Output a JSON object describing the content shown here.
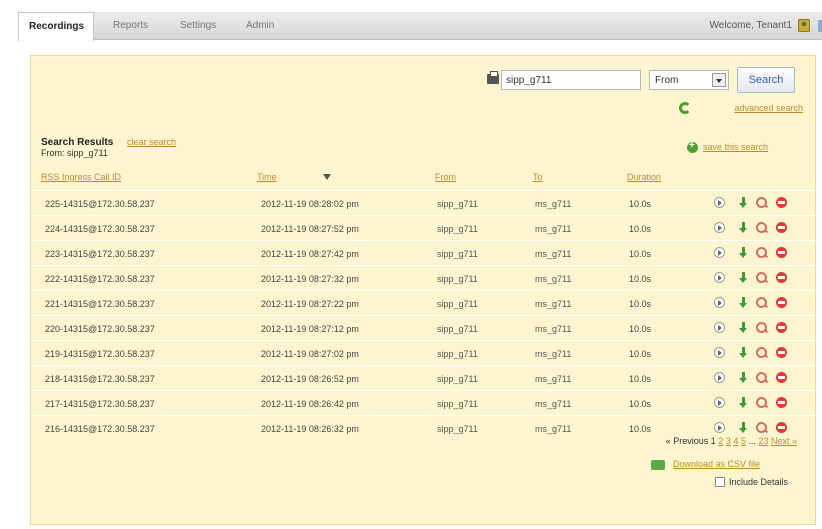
{
  "nav": {
    "tabs": [
      {
        "label": "Recordings",
        "active": true
      },
      {
        "label": "Reports",
        "active": false
      },
      {
        "label": "Settings",
        "active": false
      },
      {
        "label": "Admin",
        "active": false
      }
    ],
    "welcome": "Welcome, Tenant1"
  },
  "search": {
    "value": "sipp_g711",
    "select_value": "From",
    "button": "Search",
    "advanced_link": "advanced search"
  },
  "results": {
    "title": "Search Results",
    "clear_link": "clear search",
    "from_line": "From: sipp_g711",
    "save_link": "save this search"
  },
  "table": {
    "headers": [
      "RSS Ingress Call ID",
      "Time",
      "From",
      "To",
      "Duration"
    ],
    "rows": [
      {
        "call_id": "225-14315@172.30.58.237",
        "time": "2012-11-19 08:28:02 pm",
        "from": "sipp_g711",
        "to": "ms_g711",
        "duration": "10.0s"
      },
      {
        "call_id": "224-14315@172.30.58.237",
        "time": "2012-11-19 08:27:52 pm",
        "from": "sipp_g711",
        "to": "ms_g711",
        "duration": "10.0s"
      },
      {
        "call_id": "223-14315@172.30.58.237",
        "time": "2012-11-19 08:27:42 pm",
        "from": "sipp_g711",
        "to": "ms_g711",
        "duration": "10.0s"
      },
      {
        "call_id": "222-14315@172.30.58.237",
        "time": "2012-11-19 08:27:32 pm",
        "from": "sipp_g711",
        "to": "ms_g711",
        "duration": "10.0s"
      },
      {
        "call_id": "221-14315@172.30.58.237",
        "time": "2012-11-19 08:27:22 pm",
        "from": "sipp_g711",
        "to": "ms_g711",
        "duration": "10.0s"
      },
      {
        "call_id": "220-14315@172.30.58.237",
        "time": "2012-11-19 08:27:12 pm",
        "from": "sipp_g711",
        "to": "ms_g711",
        "duration": "10.0s"
      },
      {
        "call_id": "219-14315@172.30.58.237",
        "time": "2012-11-19 08:27:02 pm",
        "from": "sipp_g711",
        "to": "ms_g711",
        "duration": "10.0s"
      },
      {
        "call_id": "218-14315@172.30.58.237",
        "time": "2012-11-19 08:26:52 pm",
        "from": "sipp_g711",
        "to": "ms_g711",
        "duration": "10.0s"
      },
      {
        "call_id": "217-14315@172.30.58.237",
        "time": "2012-11-19 08:26:42 pm",
        "from": "sipp_g711",
        "to": "ms_g711",
        "duration": "10.0s"
      },
      {
        "call_id": "216-14315@172.30.58.237",
        "time": "2012-11-19 08:26:32 pm",
        "from": "sipp_g711",
        "to": "ms_g711",
        "duration": "10.0s"
      }
    ]
  },
  "pager": {
    "prev": "« Previous",
    "current": "1",
    "pages": [
      "2",
      "3",
      "4",
      "5"
    ],
    "ellipsis": "...",
    "last": "23",
    "next": "Next »"
  },
  "footer": {
    "csv_link": "Download as CSV file",
    "include_label": "Include Details"
  },
  "colors": {
    "panel_bg": "#fdf5d0",
    "link": "#c08a2a",
    "accent_blue": "#2a5fa8"
  }
}
